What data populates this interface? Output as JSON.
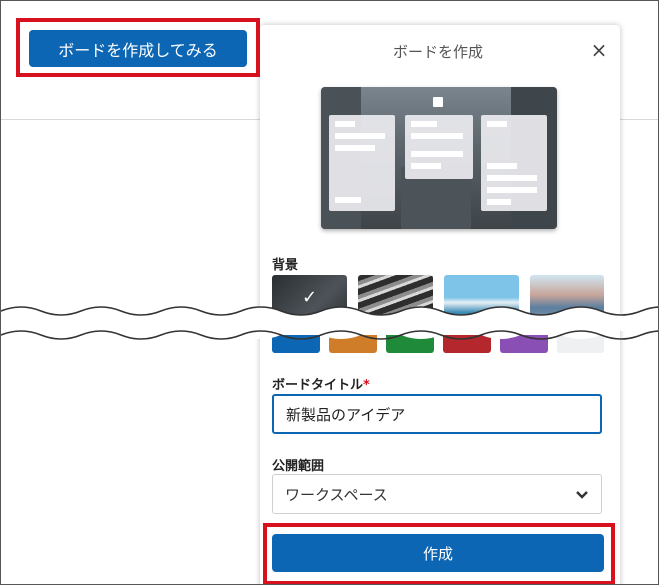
{
  "header": {
    "try_create_board_label": "ボードを作成してみる"
  },
  "panel": {
    "title": "ボードを作成",
    "close_icon": "×",
    "background_label": "背景",
    "selected_check": "✓",
    "thumbnails": [
      "dark-city",
      "metal-texture",
      "snowy-mountains",
      "colorful-houses"
    ],
    "swatch_colors": [
      "#0c66b4",
      "#d07d2a",
      "#1f8a3a",
      "#b4272d",
      "#8a4fb4",
      "#eef0f2"
    ],
    "board_title_label": "ボードタイトル",
    "required_mark": "*",
    "board_title_value": "新製品のアイデア",
    "visibility_label": "公開範囲",
    "visibility_value": "ワークスペース",
    "chevron": "⌄",
    "create_button_label": "作成"
  },
  "colors": {
    "accent": "#0c66b4",
    "highlight": "#d7111e"
  }
}
